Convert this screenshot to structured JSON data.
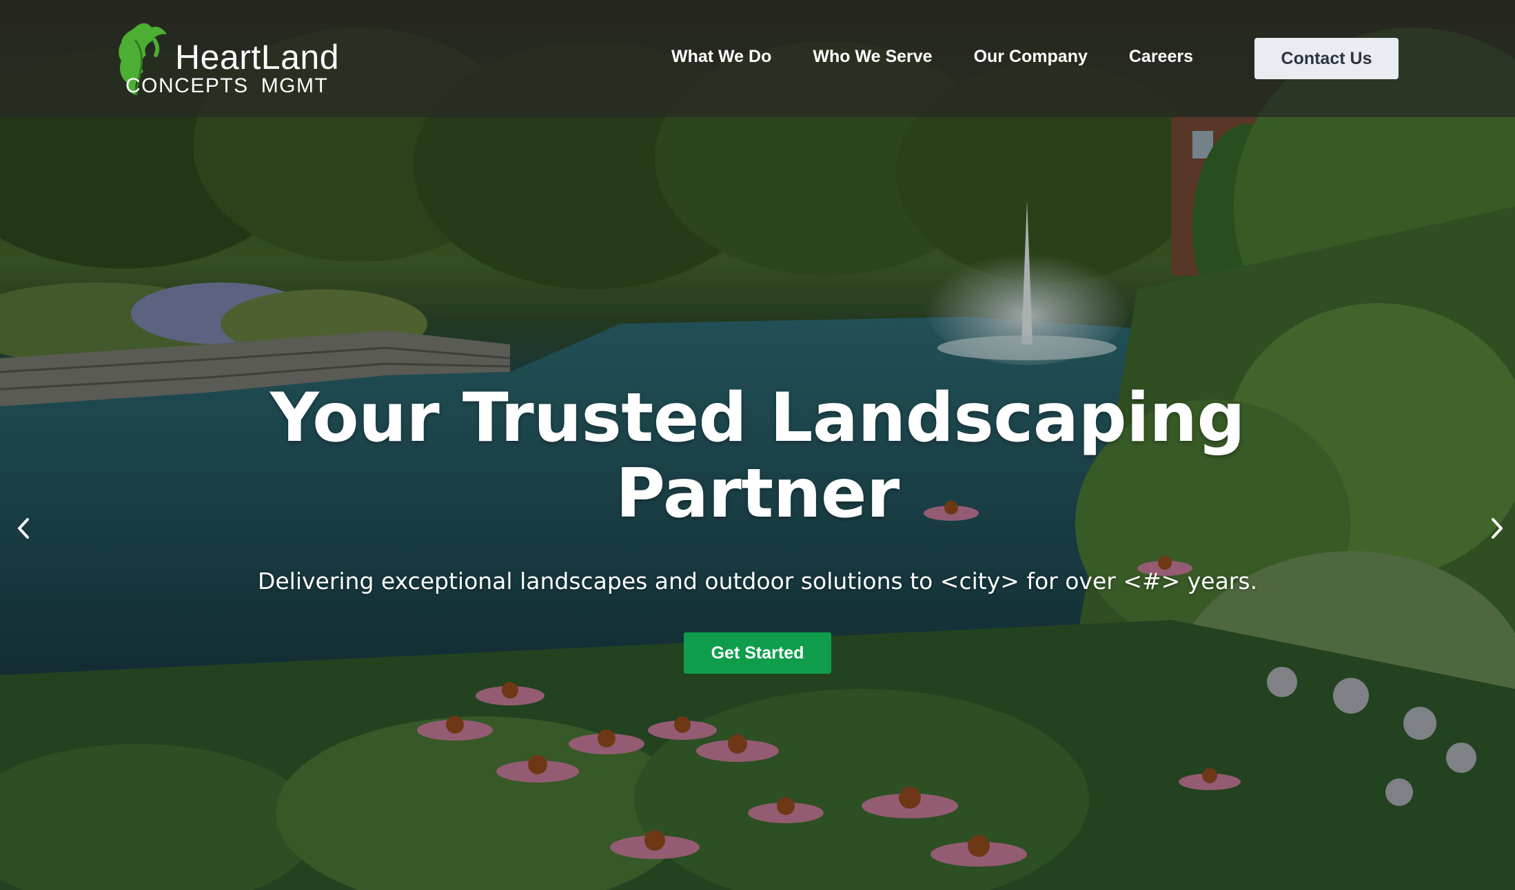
{
  "brand": {
    "name": "HeartLand",
    "sub_left": "CONCEPTS",
    "sub_right": "MGMT",
    "logo_icon": "oak-leaf-icon",
    "logo_color": "#4caf33"
  },
  "nav": {
    "items": [
      {
        "label": "What We Do"
      },
      {
        "label": "Who We Serve"
      },
      {
        "label": "Our Company"
      },
      {
        "label": "Careers"
      }
    ],
    "contact_label": "Contact Us"
  },
  "hero": {
    "title_line1": "Your Trusted Landscaping",
    "title_line2": "Partner",
    "subtitle": "Delivering exceptional landscapes and outdoor solutions to <city> for over <#> years.",
    "cta_label": "Get Started",
    "prev_icon": "chevron-left-icon",
    "next_icon": "chevron-right-icon"
  },
  "colors": {
    "accent_green": "#0f9d4c",
    "header_overlay": "#282824",
    "contact_bg": "#e9ecf1"
  }
}
